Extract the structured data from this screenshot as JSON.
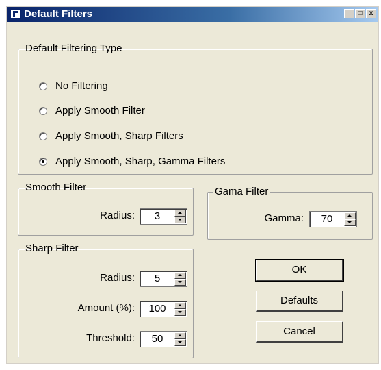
{
  "window": {
    "title": "Default Filters",
    "controls": {
      "minimize": "_",
      "maximize": "□",
      "close": "x"
    }
  },
  "filtering_type": {
    "legend": "Default Filtering Type",
    "options": [
      {
        "label": "No Filtering",
        "checked": false
      },
      {
        "label": "Apply Smooth Filter",
        "checked": false
      },
      {
        "label": "Apply Smooth, Sharp Filters",
        "checked": false
      },
      {
        "label": "Apply Smooth, Sharp, Gamma Filters",
        "checked": true
      }
    ]
  },
  "smooth_filter": {
    "legend": "Smooth Filter",
    "radius_label": "Radius:",
    "radius_value": "3"
  },
  "gamma_filter": {
    "legend": "Gama Filter",
    "gamma_label": "Gamma:",
    "gamma_value": "70"
  },
  "sharp_filter": {
    "legend": "Sharp Filter",
    "radius_label": "Radius:",
    "radius_value": "5",
    "amount_label": "Amount (%):",
    "amount_value": "100",
    "threshold_label": "Threshold:",
    "threshold_value": "50"
  },
  "buttons": {
    "ok": "OK",
    "defaults": "Defaults",
    "cancel": "Cancel"
  }
}
